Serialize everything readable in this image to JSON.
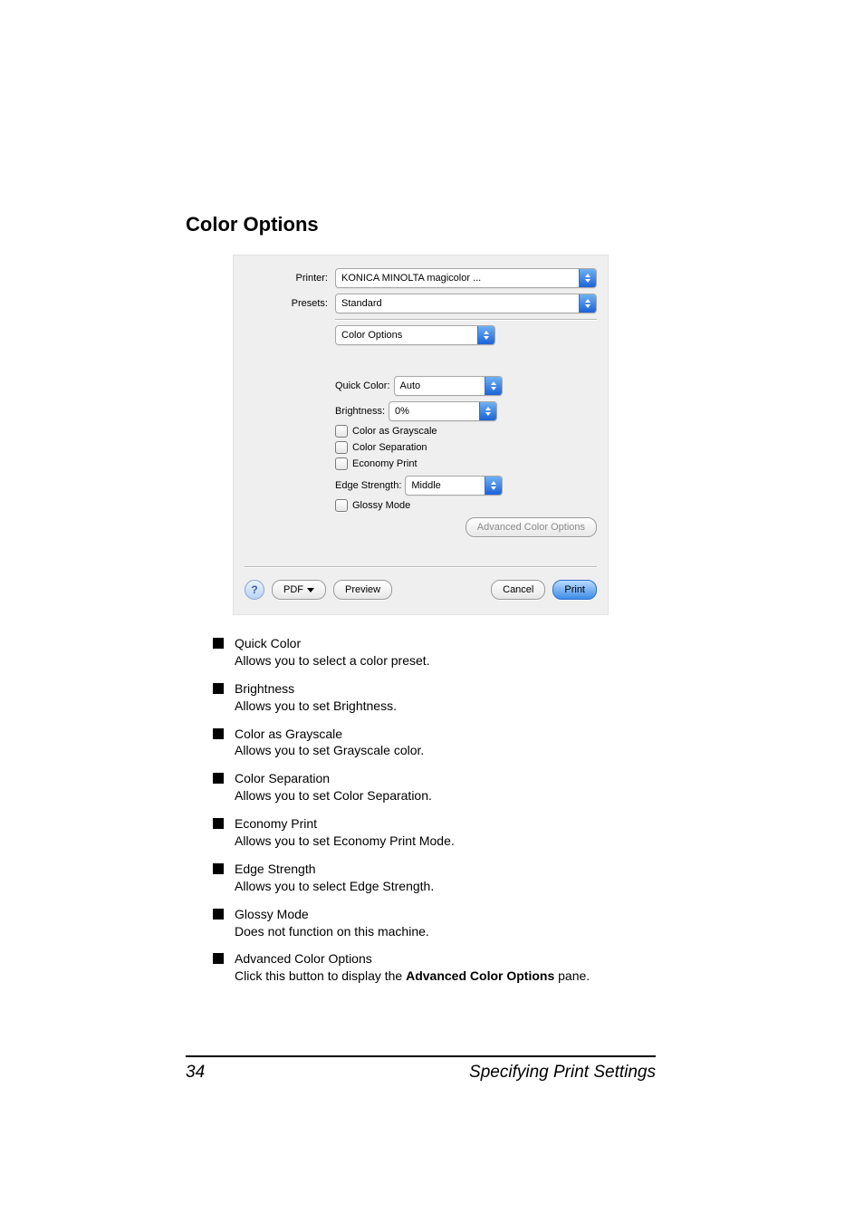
{
  "heading": "Color Options",
  "dialog": {
    "printer_label": "Printer:",
    "printer_value": "KONICA MINOLTA magicolor ...",
    "presets_label": "Presets:",
    "presets_value": "Standard",
    "pane_value": "Color Options",
    "quick_color_label": "Quick Color:",
    "quick_color_value": "Auto",
    "brightness_label": "Brightness:",
    "brightness_value": "0%",
    "cb_grayscale": "Color as Grayscale",
    "cb_separation": "Color Separation",
    "cb_economy": "Economy Print",
    "edge_label": "Edge Strength:",
    "edge_value": "Middle",
    "cb_glossy": "Glossy Mode",
    "adv_btn": "Advanced Color Options",
    "help": "?",
    "pdf_btn": "PDF",
    "preview_btn": "Preview",
    "cancel_btn": "Cancel",
    "print_btn": "Print"
  },
  "items": [
    {
      "term": "Quick Color",
      "def": "Allows you to select a color preset."
    },
    {
      "term": "Brightness",
      "def": "Allows you to set Brightness."
    },
    {
      "term": "Color as Grayscale",
      "def": "Allows you to set Grayscale color."
    },
    {
      "term": "Color Separation",
      "def": "Allows you to set Color Separation."
    },
    {
      "term": "Economy Print",
      "def": "Allows you to set Economy Print Mode."
    },
    {
      "term": "Edge Strength",
      "def": "Allows you to select Edge Strength."
    },
    {
      "term": "Glossy Mode",
      "def": "Does not function on this machine."
    }
  ],
  "last_item": {
    "term": "Advanced Color Options",
    "def_pre": "Click this button to display the ",
    "def_bold": "Advanced Color Options",
    "def_post": " pane."
  },
  "footer": {
    "page": "34",
    "section": "Specifying Print Settings"
  }
}
